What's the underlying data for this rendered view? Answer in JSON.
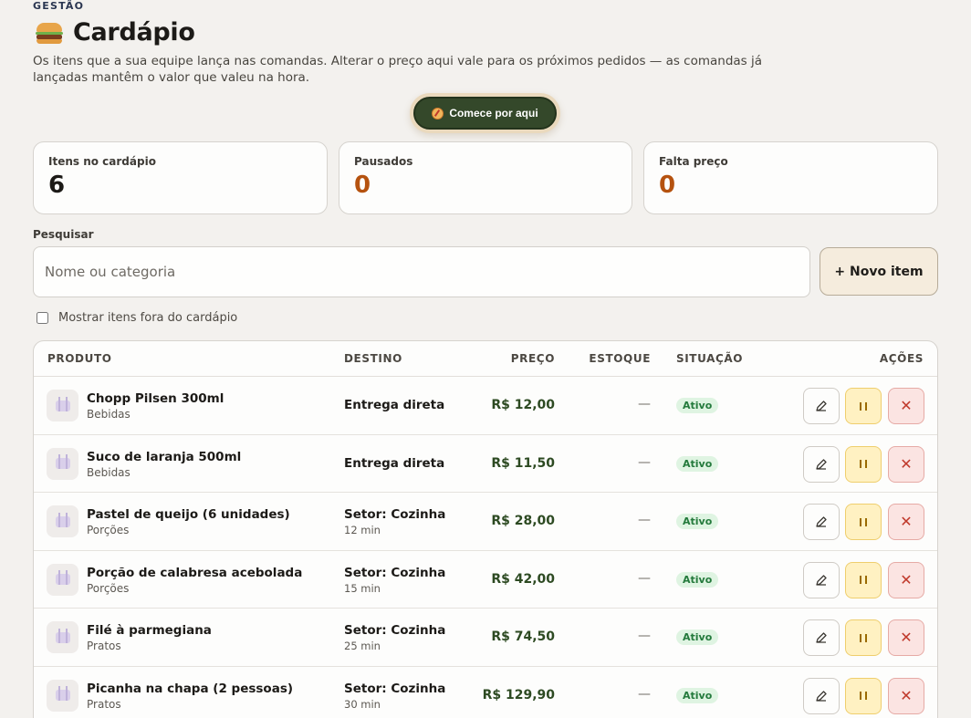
{
  "header": {
    "eyebrow": "GESTÃO",
    "title": "Cardápio",
    "subtitle": "Os itens que a sua equipe lança nas comandas. Alterar o preço aqui vale para os próximos pedidos — as comandas já lançadas mantêm o valor que valeu na hora.",
    "start_button": "Comece por aqui"
  },
  "stats": [
    {
      "label": "Itens no cardápio",
      "value": "6",
      "color": "#1c1a17"
    },
    {
      "label": "Pausados",
      "value": "0",
      "color": "#b5520f"
    },
    {
      "label": "Falta preço",
      "value": "0",
      "color": "#b5520f"
    }
  ],
  "search": {
    "label": "Pesquisar",
    "placeholder": "Nome ou categoria",
    "value": ""
  },
  "new_item_button": "+ Novo item",
  "show_hidden": {
    "label": "Mostrar itens fora do cardápio",
    "checked": false
  },
  "table": {
    "headers": {
      "produto": "PRODUTO",
      "destino": "DESTINO",
      "preco": "PREÇO",
      "estoque": "ESTOQUE",
      "situacao": "SITUAÇÃO",
      "acoes": "AÇÕES"
    },
    "rows": [
      {
        "name": "Chopp Pilsen 300ml",
        "category": "Bebidas",
        "dest": "Entrega direta",
        "dest_sub": "",
        "price": "R$ 12,00",
        "stock": "—",
        "status": "Ativo"
      },
      {
        "name": "Suco de laranja 500ml",
        "category": "Bebidas",
        "dest": "Entrega direta",
        "dest_sub": "",
        "price": "R$ 11,50",
        "stock": "—",
        "status": "Ativo"
      },
      {
        "name": "Pastel de queijo (6 unidades)",
        "category": "Porções",
        "dest": "Setor: Cozinha",
        "dest_sub": "12 min",
        "price": "R$ 28,00",
        "stock": "—",
        "status": "Ativo"
      },
      {
        "name": "Porção de calabresa acebolada",
        "category": "Porções",
        "dest": "Setor: Cozinha",
        "dest_sub": "15 min",
        "price": "R$ 42,00",
        "stock": "—",
        "status": "Ativo"
      },
      {
        "name": "Filé à parmegiana",
        "category": "Pratos",
        "dest": "Setor: Cozinha",
        "dest_sub": "25 min",
        "price": "R$ 74,50",
        "stock": "—",
        "status": "Ativo"
      },
      {
        "name": "Picanha na chapa (2 pessoas)",
        "category": "Pratos",
        "dest": "Setor: Cozinha",
        "dest_sub": "30 min",
        "price": "R$ 129,90",
        "stock": "—",
        "status": "Ativo"
      }
    ]
  }
}
